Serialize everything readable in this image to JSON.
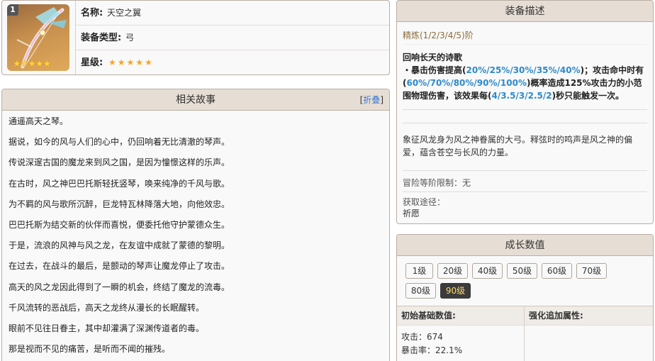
{
  "item": {
    "rarity_badge": "1",
    "name_label": "名称:",
    "name_value": "天空之翼",
    "type_label": "装备类型:",
    "type_value": "弓",
    "stars_label": "星级:",
    "stars_value": "★★★★★",
    "stars_count": 5,
    "image_stars": "★★★★★",
    "icon": "skyward-harp-bow-icon"
  },
  "story": {
    "title": "相关故事",
    "fold_open": "[",
    "fold_label": "折叠",
    "fold_close": "]",
    "lines": [
      "通遥高天之琴。",
      "据说，如今的风与人们的心中，仍回响着无比清澈的琴声。",
      "传说深邃古国的魔龙来到风之国，是因为憧憬这样的乐声。",
      "在古时，风之神巴巴托斯轻抚竖琴，唤来纯净的千风与歌。",
      "为不羁的风与歌所沉醉，巨龙特瓦林降落大地，向他效忠。",
      "巴巴托斯为结交新的伙伴而喜悦，便委托他守护蒙德众生。",
      "于是，流浪的风神与风之龙，在友谊中成就了蒙德的黎明。",
      "在过去，在战斗的最后，是颤动的琴声让魔龙停止了攻击。",
      "高天的风之龙因此得到了一瞬的机会，终结了魔龙的流毒。",
      "千风流转的恶战后，高天之龙终从漫长的长眠醒转。",
      "眼前不见往日眷主，其中却灌满了深渊传道者的毒。",
      "那是视而不见的痛苦，是听而不闻的摧残。"
    ]
  },
  "description": {
    "title": "装备描述",
    "refine": "精炼(1/2/3/4/5)阶",
    "skill_name": "回响长天的诗歌",
    "skill_p1": "・暴击伤害提高(",
    "skill_v1": "20%/25%/30%/35%/40%",
    "skill_p2": ")；攻击命中时有(",
    "skill_v2": "60%/70%/80%/90%/100%",
    "skill_p3": ")概率造成125%攻击力的小范围物理伤害，该效果每(",
    "skill_v3": "4/3.5/3/2.5/2",
    "skill_p4": ")秒只能触发一次。",
    "flavor": "象征风龙身为风之神眷属的大弓。释弦时的鸣声是风之神的偏爱，蕴含苍空与长风的力量。",
    "limit": "冒险等阶限制：无",
    "obtain_label": "获取途径：",
    "obtain_value": "祈愿",
    "highlight_color": "#2e8ac9"
  },
  "growth": {
    "title": "成长数值",
    "levels": [
      "1级",
      "20级",
      "40级",
      "50级",
      "60级",
      "70级",
      "80级",
      "90级"
    ],
    "active_level": "90级",
    "base_header": "初始基础数值:",
    "bonus_header": "强化追加属性:",
    "stats": [
      "攻击：674",
      "暴击率：22.1%"
    ]
  }
}
